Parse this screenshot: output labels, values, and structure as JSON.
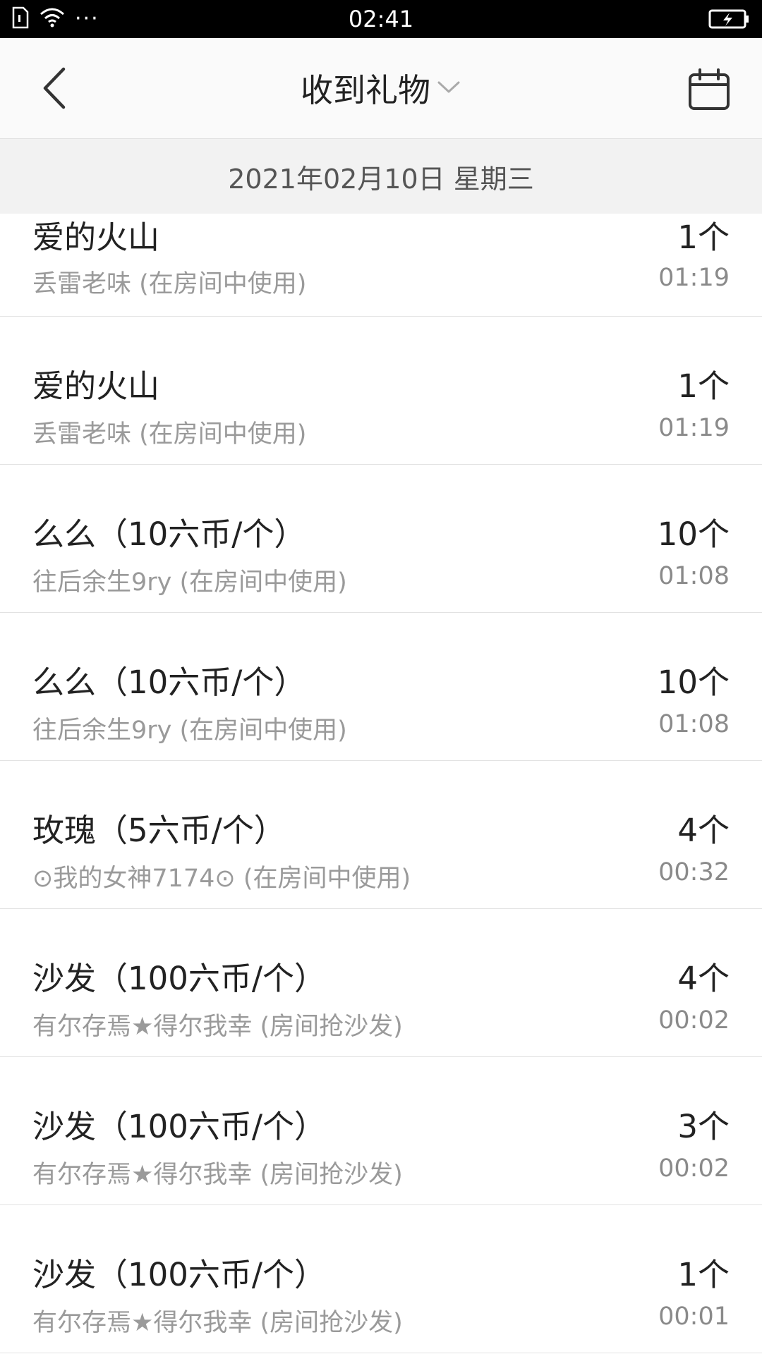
{
  "status_bar": {
    "time": "02:41",
    "more": "···"
  },
  "nav": {
    "title": "收到礼物"
  },
  "date_header": "2021年02月10日 星期三",
  "records": [
    {
      "gift": "爱的火山",
      "giver": "丢雷老味 (在房间中使用)",
      "qty": "1个",
      "time": "01:19"
    },
    {
      "gift": "爱的火山",
      "giver": "丢雷老味 (在房间中使用)",
      "qty": "1个",
      "time": "01:19"
    },
    {
      "gift": "么么（10六币/个）",
      "giver": "往后余生9ry (在房间中使用)",
      "qty": "10个",
      "time": "01:08"
    },
    {
      "gift": "么么（10六币/个）",
      "giver": "往后余生9ry (在房间中使用)",
      "qty": "10个",
      "time": "01:08"
    },
    {
      "gift": "玫瑰（5六币/个）",
      "giver": "⊙我的女神7174⊙ (在房间中使用)",
      "qty": "4个",
      "time": "00:32"
    },
    {
      "gift": "沙发（100六币/个）",
      "giver": "有尔存焉★得尔我幸 (房间抢沙发)",
      "qty": "4个",
      "time": "00:02"
    },
    {
      "gift": "沙发（100六币/个）",
      "giver": "有尔存焉★得尔我幸 (房间抢沙发)",
      "qty": "3个",
      "time": "00:02"
    },
    {
      "gift": "沙发（100六币/个）",
      "giver": "有尔存焉★得尔我幸 (房间抢沙发)",
      "qty": "1个",
      "time": "00:01"
    }
  ]
}
